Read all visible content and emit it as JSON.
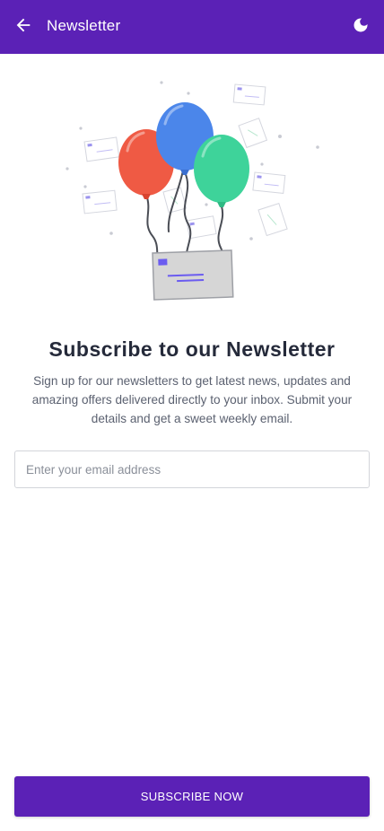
{
  "header": {
    "title": "Newsletter",
    "back_icon": "arrow-left-icon",
    "theme_icon": "moon-icon",
    "bar_color": "#5b21b6"
  },
  "illustration": {
    "name": "balloons-carrying-envelope-illustration",
    "balloon_colors": [
      "#ef5a44",
      "#4b86ea",
      "#3ed39a"
    ],
    "envelope_color": "#d6d6d6",
    "envelope_accent": "#6b5cf0"
  },
  "content": {
    "headline": "Subscribe to our Newsletter",
    "description": "Sign up for our newsletters to get latest news, updates and amazing offers delivered directly to your inbox. Submit your details and get a sweet weekly email."
  },
  "form": {
    "email_placeholder": "Enter your email address",
    "email_value": "",
    "submit_label": "SUBSCRIBE NOW"
  }
}
